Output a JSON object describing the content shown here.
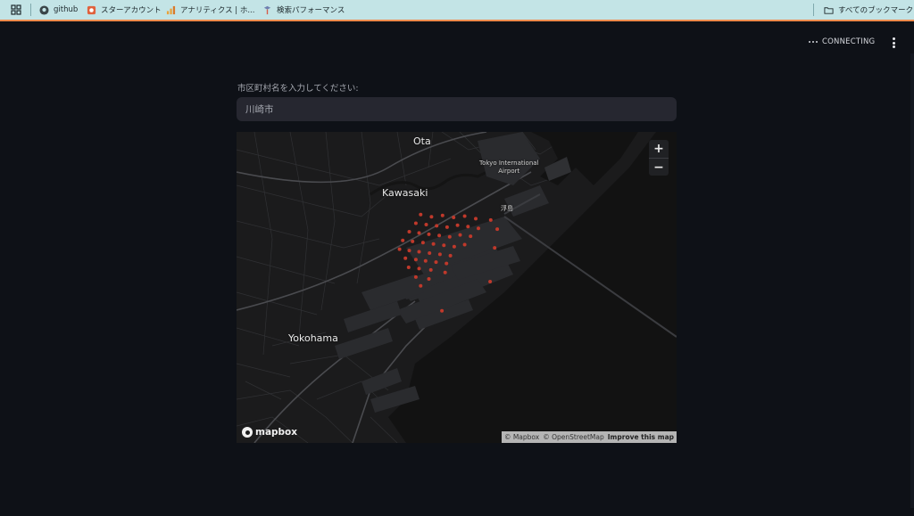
{
  "bookmarks": {
    "items": [
      {
        "label": "github",
        "icon": "github-icon"
      },
      {
        "label": "スターアカウント",
        "icon": "star-account-icon"
      },
      {
        "label": "アナリティクス | ホ...",
        "icon": "analytics-icon"
      },
      {
        "label": "検索パフォーマンス",
        "icon": "search-console-icon"
      }
    ],
    "all_bookmarks": "すべてのブックマーク"
  },
  "app": {
    "status": "CONNECTING"
  },
  "input": {
    "label": "市区町村名を入力してください:",
    "value": "川崎市"
  },
  "map": {
    "places": {
      "ota": "Ota",
      "kawasaki": "Kawasaki",
      "yokohama": "Yokohama",
      "airport_line1": "Tokyo International",
      "airport_line2": "Airport",
      "ukishima": "浮島"
    },
    "zoom_in": "+",
    "zoom_out": "−",
    "logo_text": "mapbox",
    "attribution": {
      "mapbox": "© Mapbox",
      "osm": "© OpenStreetMap",
      "improve": "Improve this map"
    },
    "point_color": "#c0392b",
    "points": [
      [
        35.5405,
        139.7165
      ],
      [
        35.5398,
        139.7198
      ],
      [
        35.5402,
        139.7232
      ],
      [
        35.5396,
        139.7266
      ],
      [
        35.54,
        139.73
      ],
      [
        35.5392,
        139.7334
      ],
      [
        35.5378,
        139.715
      ],
      [
        35.5374,
        139.7182
      ],
      [
        35.537,
        139.7214
      ],
      [
        35.5366,
        139.7246
      ],
      [
        35.5372,
        139.7278
      ],
      [
        35.5368,
        139.731
      ],
      [
        35.5362,
        139.7342
      ],
      [
        35.5352,
        139.713
      ],
      [
        35.5348,
        139.716
      ],
      [
        35.5344,
        139.719
      ],
      [
        35.534,
        139.7222
      ],
      [
        35.5336,
        139.7254
      ],
      [
        35.5342,
        139.7286
      ],
      [
        35.5338,
        139.7318
      ],
      [
        35.5325,
        139.711
      ],
      [
        35.5322,
        139.714
      ],
      [
        35.5318,
        139.7172
      ],
      [
        35.5314,
        139.7204
      ],
      [
        35.531,
        139.7236
      ],
      [
        35.5306,
        139.7268
      ],
      [
        35.5312,
        139.73
      ],
      [
        35.5298,
        139.71
      ],
      [
        35.5294,
        139.713
      ],
      [
        35.529,
        139.716
      ],
      [
        35.5286,
        139.7192
      ],
      [
        35.5282,
        139.7224
      ],
      [
        35.5278,
        139.7256
      ],
      [
        35.527,
        139.7118
      ],
      [
        35.5266,
        139.715
      ],
      [
        35.5262,
        139.718
      ],
      [
        35.5258,
        139.7212
      ],
      [
        35.5254,
        139.7244
      ],
      [
        35.5242,
        139.7128
      ],
      [
        35.5238,
        139.716
      ],
      [
        35.5234,
        139.7196
      ],
      [
        35.5226,
        139.724
      ],
      [
        35.5212,
        139.715
      ],
      [
        35.5206,
        139.719
      ],
      [
        35.5185,
        139.7165
      ],
      [
        35.536,
        139.74
      ],
      [
        35.5302,
        139.7392
      ],
      [
        35.5388,
        139.738
      ],
      [
        35.5198,
        139.7378
      ],
      [
        35.5108,
        139.723
      ]
    ]
  }
}
